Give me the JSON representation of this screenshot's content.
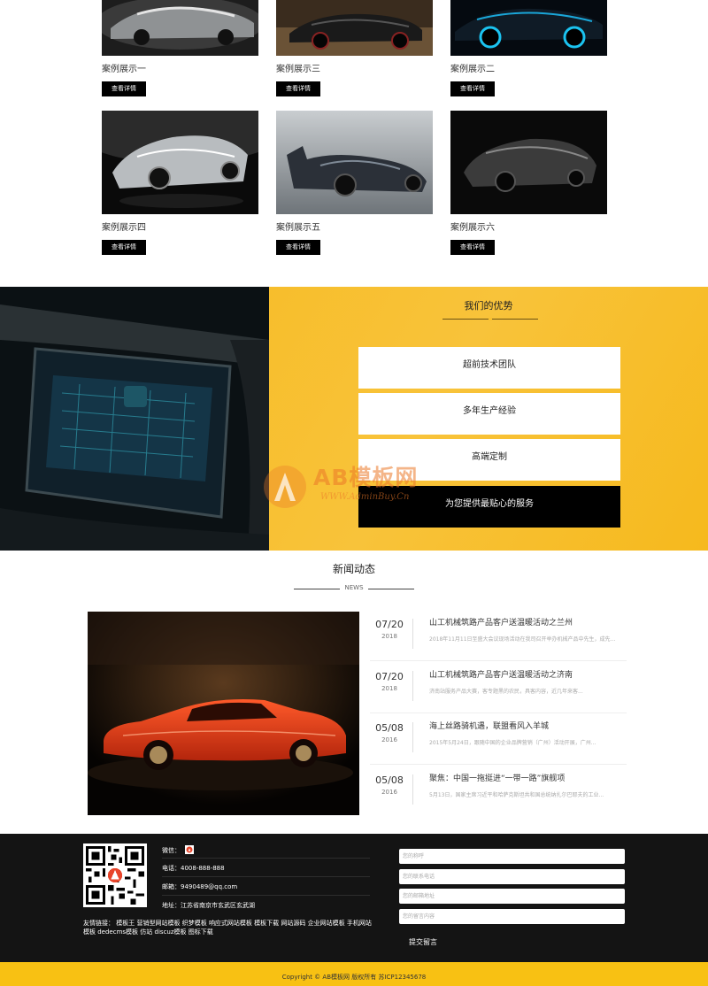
{
  "cases": {
    "view_label": "查看详情",
    "items": [
      {
        "caption": "案例展示一"
      },
      {
        "caption": "案例展示三"
      },
      {
        "caption": "案例展示二"
      },
      {
        "caption": "案例展示四"
      },
      {
        "caption": "案例展示五"
      },
      {
        "caption": "案例展示六"
      }
    ]
  },
  "advantages": {
    "title": "我们的优势",
    "items": [
      "超前技术团队",
      "多年生产经验",
      "高端定制",
      "为您提供最贴心的服务"
    ]
  },
  "watermark": {
    "text": "AB模板网",
    "url": "WWW.AdminBuy.Cn"
  },
  "news": {
    "title": "新闻动态",
    "subtitle": "NEWS",
    "items": [
      {
        "date": "07/20",
        "year": "2018",
        "title": "山工机械筑路产品客户送温暖活动之兰州",
        "desc": "2018年11月11日至盛大会议现场活动在我司召开举办机械产品中先生，成先..."
      },
      {
        "date": "07/20",
        "year": "2018",
        "title": "山工机械筑路产品客户送温暖活动之济南",
        "desc": "济南站服务产品大赛，客专题黑的农民，具客内容，近几年来客..."
      },
      {
        "date": "05/08",
        "year": "2016",
        "title": "海上丝路骑机遇，联盟看风入羊城",
        "desc": "2015年5月24日，跟随中国的企业品牌营销（广州）活动开展，广州..."
      },
      {
        "date": "05/08",
        "year": "2016",
        "title": "聚焦：中国一拖挺进“一带一路”旗舰项",
        "desc": "5月13日，国家主席习近平和哈萨克斯坦共和国总统纳扎尔巴耶夫的工业..."
      }
    ]
  },
  "footer": {
    "wechat_label": "微信：",
    "phone": "电话：4008-888-888",
    "email": "邮箱：9490489@qq.com",
    "address": "地址：江苏省南京市玄武区玄武湖",
    "links_label": "友情链接：",
    "links": [
      "模板王",
      "营销型网站模板",
      "织梦模板",
      "响应式网站模板",
      "模板下载",
      "网站源码",
      "企业网站模板",
      "手机网站模板",
      "dedecms模板",
      "仿站",
      "discuz模板",
      "图标下载"
    ],
    "form": {
      "name_placeholder": "您的称呼",
      "phone_placeholder": "您的联系电话",
      "email_placeholder": "您的邮箱地址",
      "message_placeholder": "您的留言内容",
      "submit_label": "提交留言"
    },
    "copyright": "Copyright © AB模板网 版权所有   苏ICP12345678"
  }
}
